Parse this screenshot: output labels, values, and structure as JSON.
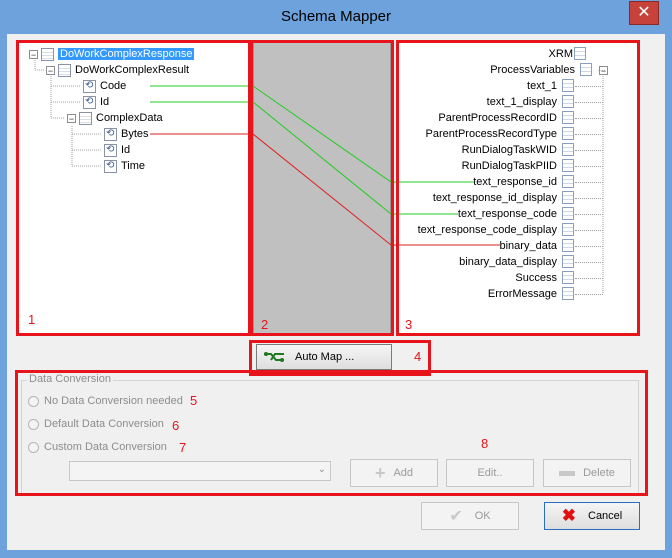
{
  "window": {
    "title": "Schema Mapper",
    "close_glyph": "✕"
  },
  "source_tree": {
    "items": [
      {
        "label": "DoWorkComplexResponse",
        "selected": true
      },
      {
        "label": "DoWorkComplexResult"
      },
      {
        "label": "Code"
      },
      {
        "label": "Id"
      },
      {
        "label": "ComplexData"
      },
      {
        "label": "Bytes"
      },
      {
        "label": "Id"
      },
      {
        "label": "Time"
      }
    ]
  },
  "target_tree": {
    "root": "XRM",
    "parent": "ProcessVariables",
    "items": [
      "text_1",
      "text_1_display",
      "ParentProcessRecordID",
      "ParentProcessRecordType",
      "RunDialogTaskWID",
      "RunDialogTaskPIID",
      "text_response_id",
      "text_response_id_display",
      "text_response_code",
      "text_response_code_display",
      "binary_data",
      "binary_data_display",
      "Success",
      "ErrorMessage"
    ]
  },
  "mappings": [
    {
      "from": "Code",
      "to": "text_response_id",
      "color": "#22cc22"
    },
    {
      "from": "Id",
      "to": "text_response_code",
      "color": "#22cc22"
    },
    {
      "from": "Bytes",
      "to": "binary_data",
      "color": "#dd2222"
    }
  ],
  "auto_map": {
    "label": "Auto Map ..."
  },
  "data_conversion": {
    "group_label": "Data Conversion",
    "options": [
      "No Data Conversion needed",
      "Default Data Conversion",
      "Custom Data Conversion"
    ],
    "dropdown_value": "",
    "add_label": "Add",
    "edit_label": "Edit..",
    "delete_label": "Delete"
  },
  "footer": {
    "ok_label": "OK",
    "cancel_label": "Cancel"
  },
  "annotations": [
    "1",
    "2",
    "3",
    "4",
    "5",
    "6",
    "7",
    "8"
  ],
  "colors": {
    "annotation": "#e8141b",
    "link_green": "#22cc22",
    "link_red": "#dd2222",
    "selection": "#3399ff"
  }
}
